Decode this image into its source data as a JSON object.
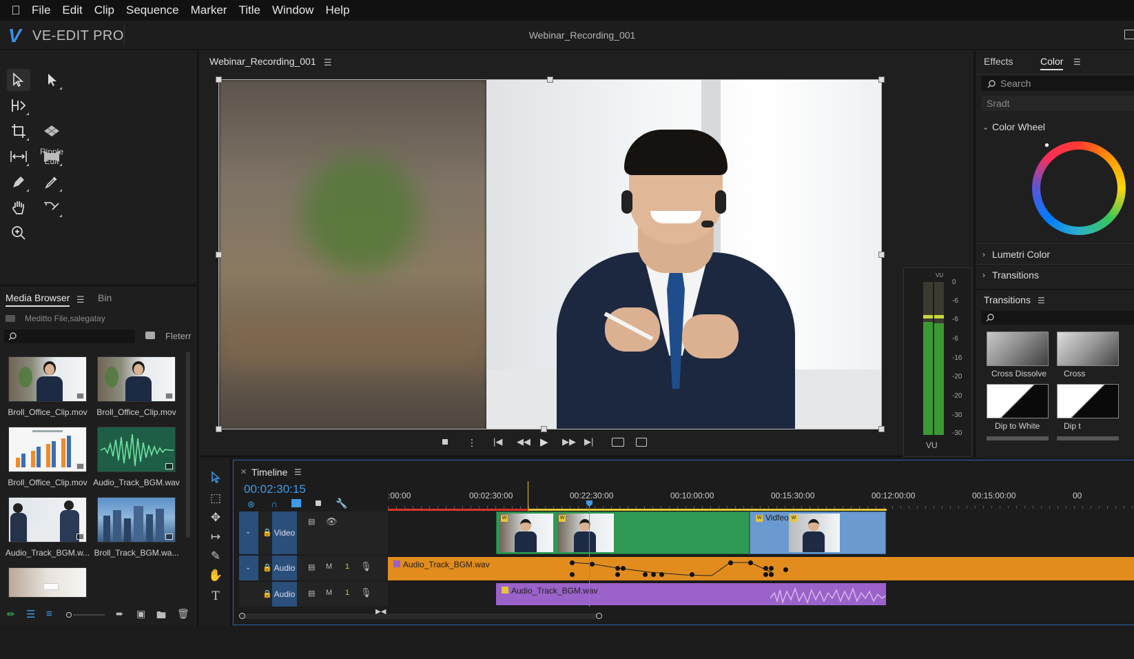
{
  "menubar": {
    "items": [
      "File",
      "Edit",
      "Clip",
      "Sequence",
      "Marker",
      "Title",
      "Window",
      "Help"
    ]
  },
  "app": {
    "logo_letter": "V",
    "name": "VE-EDIT PRO",
    "document_title": "Webinar_Recording_001"
  },
  "tools": {
    "ripple_label": "Ripple Edit",
    "icons": [
      "selection-tool-icon",
      "track-select-icon",
      "ripple-edit-icon",
      "crop-tool-icon",
      "rate-stretch-icon",
      "slip-tool-icon",
      "slide-tool-icon",
      "pen-tool-icon",
      "eyedropper-icon",
      "hand-tool-icon",
      "path-tool-icon",
      "zoom-tool-icon"
    ]
  },
  "media_browser": {
    "tab_active": "Media Browser",
    "tab_other": "Bin",
    "path": "Meditto File,salegatay",
    "filter_label": "Fleterr",
    "items": [
      {
        "label": "Broll_Office_Clip.mov",
        "kind": "office"
      },
      {
        "label": "Broll_Office_Clip.mov",
        "kind": "office"
      },
      {
        "label": "Broll_Office_Clip.mov",
        "kind": "chart"
      },
      {
        "label": "Audio_Track_BGM.wav",
        "kind": "audio"
      },
      {
        "label": "Audio_Track_BGM.w...",
        "kind": "meeting"
      },
      {
        "label": "Broll_Track_BGM.wa...",
        "kind": "city"
      },
      {
        "label": "",
        "kind": "room"
      }
    ]
  },
  "program": {
    "title": "Webinar_Recording_001"
  },
  "vu": {
    "top_label": "VU",
    "bottom_label": "VU",
    "ticks": [
      "0",
      "-6",
      "-6",
      "-6",
      "-16",
      "-20",
      "-20",
      "-30",
      "-30"
    ],
    "level": 0.74,
    "peak": 0.76
  },
  "right_panel": {
    "tab_effects": "Effects",
    "tab_color": "Color",
    "search_placeholder": "Search",
    "field_value": "Sradt",
    "section_color_wheel": "Color Wheel",
    "section_lumetri": "Lumetri Color",
    "section_transitions": "Transitions"
  },
  "transitions_panel": {
    "title": "Transitions",
    "items": [
      {
        "label": "Cross Dissolve"
      },
      {
        "label": "Cross"
      },
      {
        "label": "Dip to White"
      },
      {
        "label": "Dip t"
      }
    ]
  },
  "timeline": {
    "title": "Timeline",
    "timecode": "00:02:30:15",
    "ruler": [
      ":00:00",
      "00:02:30:00",
      "00:22:30:00",
      "00:10:00:00",
      "00:15:30:00",
      "00:12:00:00",
      "00:15:00:00",
      "00"
    ],
    "tracks": [
      {
        "name": "Video",
        "m": "",
        "num": ""
      },
      {
        "name": "Audio",
        "m": "M",
        "num": "1"
      },
      {
        "name": "Audio",
        "m": "M",
        "num": "1"
      }
    ],
    "clips": {
      "video_badge": "W",
      "video_label": "Vidfeo",
      "audio1_label": "Audio_Track_BGM.wav",
      "audio2_label": "Audio_Track_BGM.wav"
    }
  },
  "colors": {
    "accent": "#3d9be9",
    "video_clip": "#2f9a54",
    "video_clip_alt": "#6b9ad0",
    "audio_clip": "#e18c1d",
    "audio_clip_alt": "#9b62c9"
  }
}
